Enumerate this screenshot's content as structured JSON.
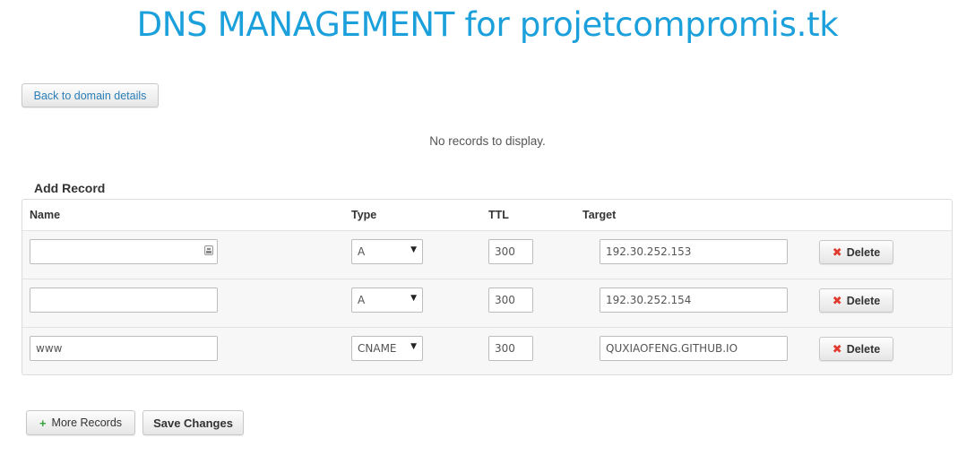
{
  "page": {
    "title": "DNS MANAGEMENT for projetcompromis.tk",
    "back_label": "Back to domain details",
    "no_records": "No records to display.",
    "accent_color": "#1ba0db"
  },
  "add_record": {
    "title": "Add Record",
    "headers": {
      "name": "Name",
      "type": "Type",
      "ttl": "TTL",
      "target": "Target"
    },
    "rows": [
      {
        "name": "",
        "type": "A",
        "ttl": "300",
        "target": "192.30.252.153",
        "delete_label": "Delete"
      },
      {
        "name": "",
        "type": "A",
        "ttl": "300",
        "target": "192.30.252.154",
        "delete_label": "Delete"
      },
      {
        "name": "www",
        "type": "CNAME",
        "ttl": "300",
        "target": "QUXIAOFENG.GITHUB.IO",
        "delete_label": "Delete"
      }
    ]
  },
  "actions": {
    "more_records": "More Records",
    "save_changes": "Save Changes"
  },
  "icons": {
    "delete": "x-icon",
    "more": "plus-icon",
    "name_field_contact": "contact-card-icon",
    "dropdown": "caret-down-icon"
  }
}
